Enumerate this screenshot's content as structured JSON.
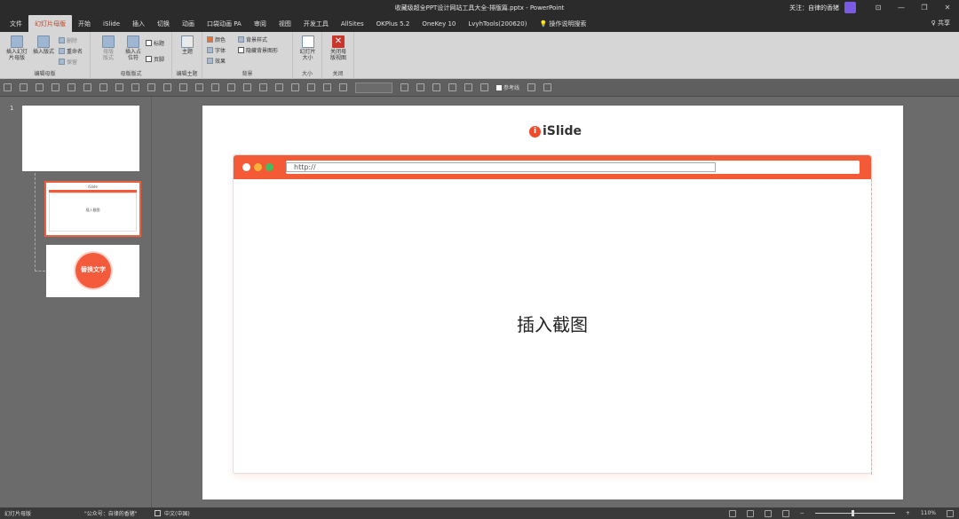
{
  "window": {
    "title": "收藏级超全PPT设计网站工具大全-排版篇.pptx  -  PowerPoint",
    "follow_label": "关注：自律的香猪",
    "controls": [
      "⊡",
      "—",
      "❐",
      "✕"
    ]
  },
  "tabs": [
    {
      "label": "文件"
    },
    {
      "label": "幻灯片母版",
      "active": true
    },
    {
      "label": "开始"
    },
    {
      "label": "iSlide"
    },
    {
      "label": "插入"
    },
    {
      "label": "切换"
    },
    {
      "label": "动画"
    },
    {
      "label": "口袋动画 PA"
    },
    {
      "label": "审阅"
    },
    {
      "label": "视图"
    },
    {
      "label": "开发工具"
    },
    {
      "label": "AllSites"
    },
    {
      "label": "OKPlus 5.2"
    },
    {
      "label": "OneKey 10"
    },
    {
      "label": "LvyhTools(200620)"
    },
    {
      "label": "💡 操作说明搜索"
    }
  ],
  "share_label": "♀ 共享",
  "ribbon": {
    "edit_master": {
      "label": "编辑母版",
      "insert_master": "插入幻灯片母版",
      "insert_layout": "插入版式",
      "delete": "删除",
      "rename": "重命名",
      "preserve": "保留"
    },
    "master_layout": {
      "label": "母版版式",
      "master_layout_btn": "母版版式",
      "insert_placeholder": "插入占位符",
      "title_check": "标题",
      "footer_check": "页脚"
    },
    "edit_theme": {
      "label": "编辑主题",
      "theme_btn": "主题"
    },
    "background": {
      "label": "背景",
      "colors": "颜色",
      "fonts": "字体",
      "effects": "效果",
      "bg_styles": "背景样式",
      "hide_bg": "隐藏背景图形"
    },
    "size": {
      "label": "大小",
      "slide_size": "幻灯片大小"
    },
    "close": {
      "label": "关闭",
      "close_master": "关闭母版视图"
    }
  },
  "qat": {
    "ref_line": "参考线"
  },
  "thumbnails": {
    "slide_number": "1",
    "layout2_logo": "iSlide",
    "layout2_text": "插入截图",
    "layout3_text": "替换文字"
  },
  "slide": {
    "logo_mark": "i",
    "logo_word": "iSlide",
    "address": "http://",
    "placeholder": "插入截图",
    "colors": {
      "bar": "#f55a36",
      "dot_close": "#ffffff",
      "dot_min": "#f9b23a",
      "dot_max": "#3fbf5f"
    }
  },
  "status": {
    "view": "幻灯片母版",
    "theme": "\"公众号：自律的香猪\"",
    "language": "中文(中国)",
    "zoom": "110%",
    "zoom_fraction": 0.47
  }
}
